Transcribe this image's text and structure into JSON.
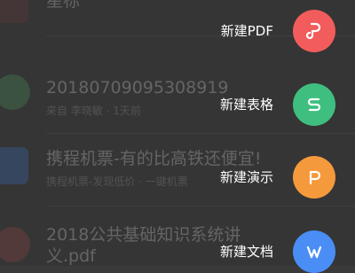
{
  "files": [
    {
      "title": "星标",
      "meta": "",
      "icon": "pdf-file-icon",
      "color": "#4a3b3b"
    },
    {
      "title": "20180709095308919",
      "meta": "来自 李晓敏 · 1天前",
      "icon": "spreadsheet-file-icon",
      "color": "#3f5a45"
    },
    {
      "title": "携程机票-有的比高铁还便宜!",
      "meta": "携程机票-发现低价 · 一键机票",
      "icon": "webpage-file-icon",
      "color": "#3b4c66"
    },
    {
      "title": "2018公共基础知识系统讲",
      "title2": "义.pdf",
      "meta": "",
      "icon": "pdf-file-icon",
      "color": "#5a3f3f"
    }
  ],
  "menu": [
    {
      "label": "新建PDF",
      "icon": "pdf-icon",
      "color": "#f25c5c"
    },
    {
      "label": "新建表格",
      "icon": "spreadsheet-icon",
      "color": "#3fbf7f"
    },
    {
      "label": "新建演示",
      "icon": "presentation-icon",
      "color": "#f59a3c"
    },
    {
      "label": "新建文档",
      "icon": "document-icon",
      "color": "#4a8ef5"
    }
  ]
}
